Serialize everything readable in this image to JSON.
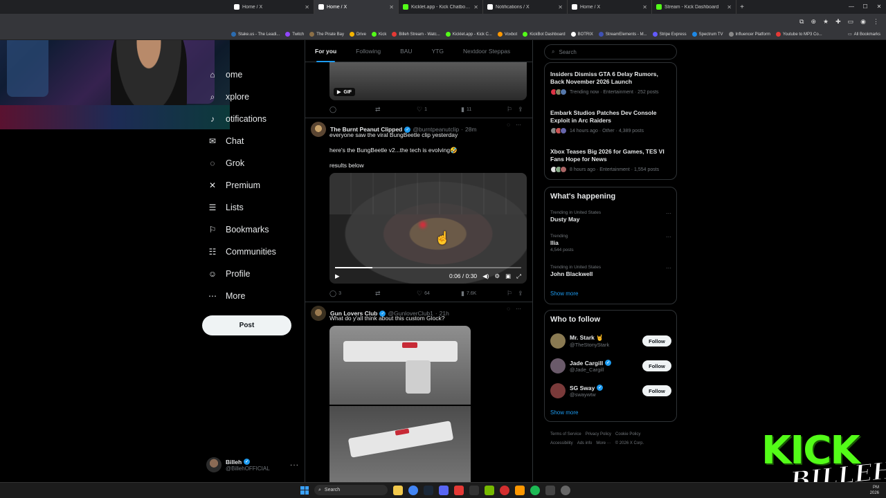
{
  "browser": {
    "tabs": [
      {
        "label": "Home / X",
        "color": "#ffffff",
        "active": false
      },
      {
        "label": "Home / X",
        "color": "#ffffff",
        "active": true
      },
      {
        "label": "Kicklet.app - Kick Chatbot and",
        "color": "#53fc18",
        "active": false
      },
      {
        "label": "Notifications / X",
        "color": "#ffffff",
        "active": false
      },
      {
        "label": "Home / X",
        "color": "#ffffff",
        "active": false
      },
      {
        "label": "Stream - Kick Dashboard",
        "color": "#53fc18",
        "active": false
      }
    ],
    "new_tab": "+",
    "bookmarks": [
      {
        "label": "Stake.us - The Leadi...",
        "color": "#2b6cb0"
      },
      {
        "label": "Twitch",
        "color": "#9146ff"
      },
      {
        "label": "The Pirate Bay",
        "color": "#8b6f47"
      },
      {
        "label": "Drive",
        "color": "#f4b400"
      },
      {
        "label": "Kick",
        "color": "#53fc18"
      },
      {
        "label": "Billeh Stream - Watc...",
        "color": "#e53935"
      },
      {
        "label": "Kicklet.app - Kick C...",
        "color": "#53fc18"
      },
      {
        "label": "Voxbot",
        "color": "#ff9800"
      },
      {
        "label": "KickBot Dashboard",
        "color": "#53fc18"
      },
      {
        "label": "BOTRIX",
        "color": "#ffffff"
      },
      {
        "label": "StreamElements - M...",
        "color": "#3f51b5"
      },
      {
        "label": "Stripe Express",
        "color": "#635bff"
      },
      {
        "label": "Spectrum TV",
        "color": "#1e88e5"
      },
      {
        "label": "Influencer Platform",
        "color": "#888888"
      },
      {
        "label": "Youtube to MP3 Co...",
        "color": "#e53935"
      }
    ],
    "all_bookmarks": "All Bookmarks"
  },
  "nav": {
    "items": [
      {
        "label": "ome",
        "icon": "home-icon",
        "glyph": "⌂"
      },
      {
        "label": "xplore",
        "icon": "explore-icon",
        "glyph": "⌕"
      },
      {
        "label": "otifications",
        "icon": "bell-icon",
        "glyph": "♪"
      },
      {
        "label": "Chat",
        "icon": "mail-icon",
        "glyph": "✉"
      },
      {
        "label": "Grok",
        "icon": "grok-icon",
        "glyph": "◌"
      },
      {
        "label": "Premium",
        "icon": "x-logo-icon",
        "glyph": "✕"
      },
      {
        "label": "Lists",
        "icon": "list-icon",
        "glyph": "☰"
      },
      {
        "label": "Bookmarks",
        "icon": "bookmark-icon",
        "glyph": "⚐"
      },
      {
        "label": "Communities",
        "icon": "people-icon",
        "glyph": "☷"
      },
      {
        "label": "Profile",
        "icon": "person-icon",
        "glyph": "☺"
      },
      {
        "label": "More",
        "icon": "more-circle-icon",
        "glyph": "⋯"
      }
    ],
    "post_button": "Post",
    "account": {
      "name": "Billeh",
      "handle": "@BillehOFFICIAL"
    }
  },
  "feed": {
    "tabs": [
      "For you",
      "Following",
      "BAU",
      "YTG",
      "Nextdoor Steppas"
    ],
    "gif_badge": "GIF",
    "tweet0_actions": {
      "replies": "",
      "reposts": "",
      "likes": "1",
      "views": "11"
    },
    "tweet1": {
      "name": "The Burnt Peanut Clipped",
      "handle": "@burntpeanutclip",
      "time": "28m",
      "lines": [
        "everyone saw the viral BungBeetle clip yesterday",
        "here's the BungBeetle v2...the tech is evolving🤣",
        "results below"
      ],
      "video_time": "0:06 / 0:30",
      "video_progress": 0.2,
      "replies": "3",
      "reposts": "",
      "likes": "64",
      "views": "7.6K"
    },
    "tweet2": {
      "name": "Gun Lovers Club",
      "handle": "@GunloverClub1",
      "time": "21h",
      "text": "What do y'all think about this custom Glock?"
    }
  },
  "sidebar": {
    "search_placeholder": "Search",
    "news": [
      {
        "title": "Insiders Dismiss GTA 6 Delay Rumors, Back November 2026 Launch",
        "meta": "Trending now · Entertainment · 252 posts"
      },
      {
        "title": "Embark Studios Patches Dev Console Exploit in Arc Raiders",
        "meta": "14 hours ago · Other · 4,389 posts"
      },
      {
        "title": "Xbox Teases Big 2026 for Games, TES VI Fans Hope for News",
        "meta": "8 hours ago · Entertainment · 1,554 posts"
      }
    ],
    "happening_title": "What's happening",
    "trends": [
      {
        "context": "Trending in United States",
        "name": "Dusty May",
        "count": ""
      },
      {
        "context": "Trending",
        "name": "Ilia",
        "count": "4,544 posts"
      },
      {
        "context": "Trending in United States",
        "name": "John Blackwell",
        "count": ""
      }
    ],
    "show_more": "Show more",
    "who_to_follow_title": "Who to follow",
    "follow": [
      {
        "name": "Mr. Stark 🤘",
        "handle": "@TheStonyStark",
        "verified": false,
        "avatar": "#8a7a52"
      },
      {
        "name": "Jade Cargill",
        "handle": "@Jade_Cargill",
        "verified": true,
        "avatar": "#6a5a6a"
      },
      {
        "name": "SG Sway",
        "handle": "@swaywtw",
        "verified": true,
        "avatar": "#7a3a3a"
      }
    ],
    "follow_label": "Follow",
    "footer": [
      "Terms of Service",
      "Privacy Policy",
      "Cookie Policy",
      "Accessibility",
      "Ads info",
      "More ···",
      "© 2026 X Corp."
    ]
  },
  "overlay": {
    "kick": "KICK",
    "name": "BILLEH"
  },
  "taskbar": {
    "search": "Search",
    "time": "PM",
    "date": "2026"
  }
}
